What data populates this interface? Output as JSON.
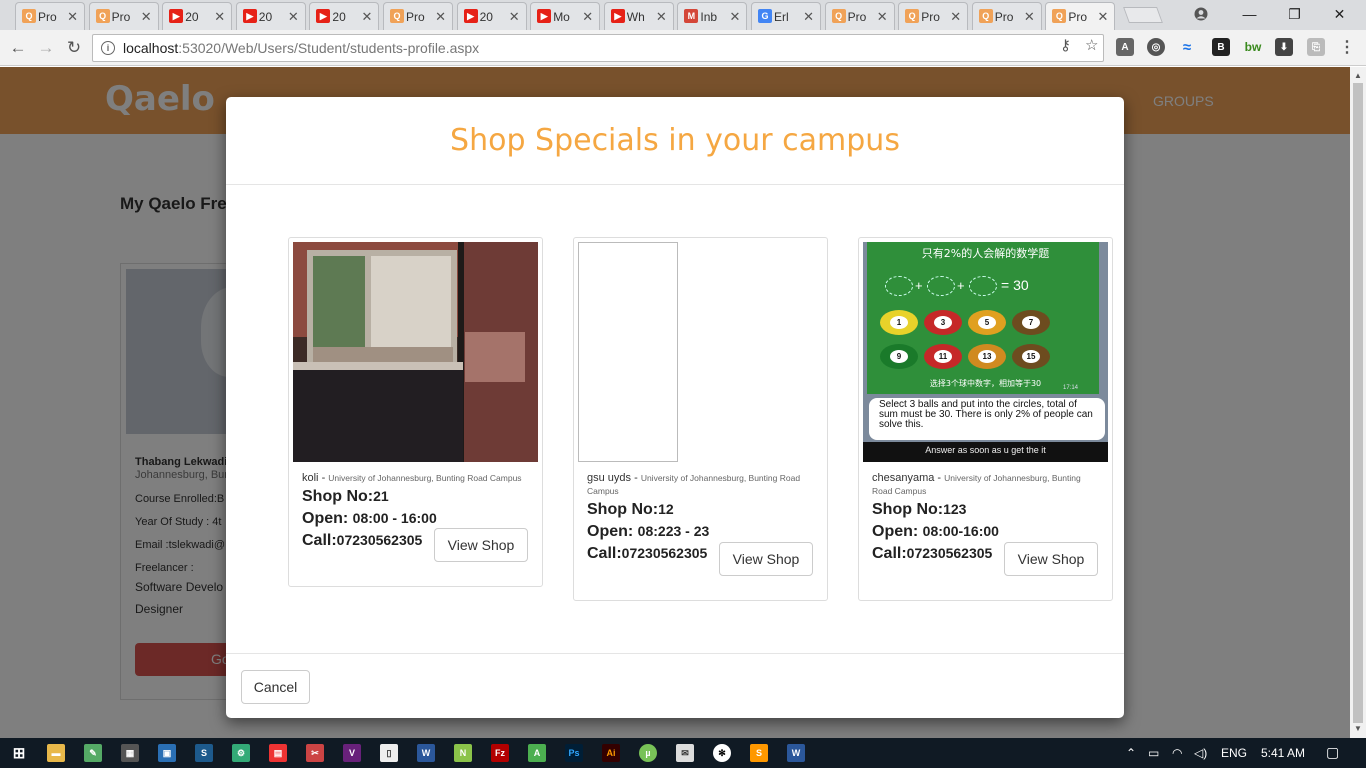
{
  "browser": {
    "tabs": [
      {
        "title": "Pro",
        "icon": "qaelo-icon",
        "color": "#f0a258",
        "glyph": "Q"
      },
      {
        "title": "Pro",
        "icon": "qaelo-icon",
        "color": "#f0a258",
        "glyph": "Q"
      },
      {
        "title": "20",
        "icon": "youtube-icon",
        "color": "#e62117",
        "glyph": "▶"
      },
      {
        "title": "20",
        "icon": "youtube-icon",
        "color": "#e62117",
        "glyph": "▶"
      },
      {
        "title": "20",
        "icon": "youtube-icon",
        "color": "#e62117",
        "glyph": "▶"
      },
      {
        "title": "Pro",
        "icon": "qaelo-icon",
        "color": "#f0a258",
        "glyph": "Q"
      },
      {
        "title": "20",
        "icon": "youtube-icon",
        "color": "#e62117",
        "glyph": "▶"
      },
      {
        "title": "Mo",
        "icon": "youtube-icon",
        "color": "#e62117",
        "glyph": "▶"
      },
      {
        "title": "Wh",
        "icon": "youtube-icon",
        "color": "#e62117",
        "glyph": "▶"
      },
      {
        "title": "Inb",
        "icon": "gmail-icon",
        "color": "#d44638",
        "glyph": "M"
      },
      {
        "title": "Erl",
        "icon": "google-icon",
        "color": "#4285f4",
        "glyph": "G"
      },
      {
        "title": "Pro",
        "icon": "qaelo-icon",
        "color": "#f0a258",
        "glyph": "Q"
      },
      {
        "title": "Pro",
        "icon": "qaelo-icon",
        "color": "#f0a258",
        "glyph": "Q"
      },
      {
        "title": "Pro",
        "icon": "qaelo-icon",
        "color": "#f0a258",
        "glyph": "Q"
      },
      {
        "title": "Pro",
        "icon": "qaelo-icon",
        "color": "#f0a258",
        "glyph": "Q",
        "active": true
      }
    ],
    "url_host": "localhost",
    "url_path": ":53020/Web/Users/Student/students-profile.aspx"
  },
  "site": {
    "logo": "Qaelo",
    "nav_groups": "GROUPS",
    "page_title": "My Qaelo Free",
    "profile": {
      "name": "Thabang Lekwadi",
      "location": "Johannesburg, Bunt",
      "course": "Course Enrolled:B",
      "year": "Year Of Study : 4t",
      "email": "Email :tslekwadi@",
      "freelancer": "Freelancer :",
      "role1": "Software Develo",
      "role2": "Designer",
      "button": "Go"
    }
  },
  "modal": {
    "title": "Shop Specials in your campus",
    "cancel": "Cancel",
    "shops": [
      {
        "name": "koli",
        "location": "University of Johannesburg, Bunting Road Campus",
        "shop_no_label": "Shop No:",
        "shop_no": "21",
        "open_label": "Open:",
        "open": "08:00 - 16:00",
        "call_label": "Call:",
        "call": "07230562305",
        "button": "View Shop"
      },
      {
        "name": "gsu uyds",
        "location": "University of Johannesburg, Bunting Road Campus",
        "shop_no_label": "Shop No:",
        "shop_no": "12",
        "open_label": "Open:",
        "open": "08:223 - 23",
        "call_label": "Call:",
        "call": "07230562305",
        "button": "View Shop"
      },
      {
        "name": "chesanyama",
        "location": "University of Johannesburg, Bunting Road Campus",
        "shop_no_label": "Shop No:",
        "shop_no": "123",
        "open_label": "Open:",
        "open": "08:00-16:00",
        "call_label": "Call:",
        "call": "07230562305",
        "button": "View Shop",
        "image_text": {
          "top": "只有2%的人会解的数学题",
          "eq": "= 30",
          "balls": [
            "1",
            "3",
            "5",
            "7",
            "9",
            "11",
            "13",
            "15"
          ],
          "hint": "选择3个球中数字，相加等于30",
          "time": "17:14",
          "caption": "Select 3 balls and put into the circles, total of sum must be 30. There is only 2% of people can solve this.",
          "bottom": "Answer as soon as u get the it"
        }
      }
    ]
  },
  "taskbar": {
    "language": "ENG",
    "time": "5:41 AM"
  }
}
